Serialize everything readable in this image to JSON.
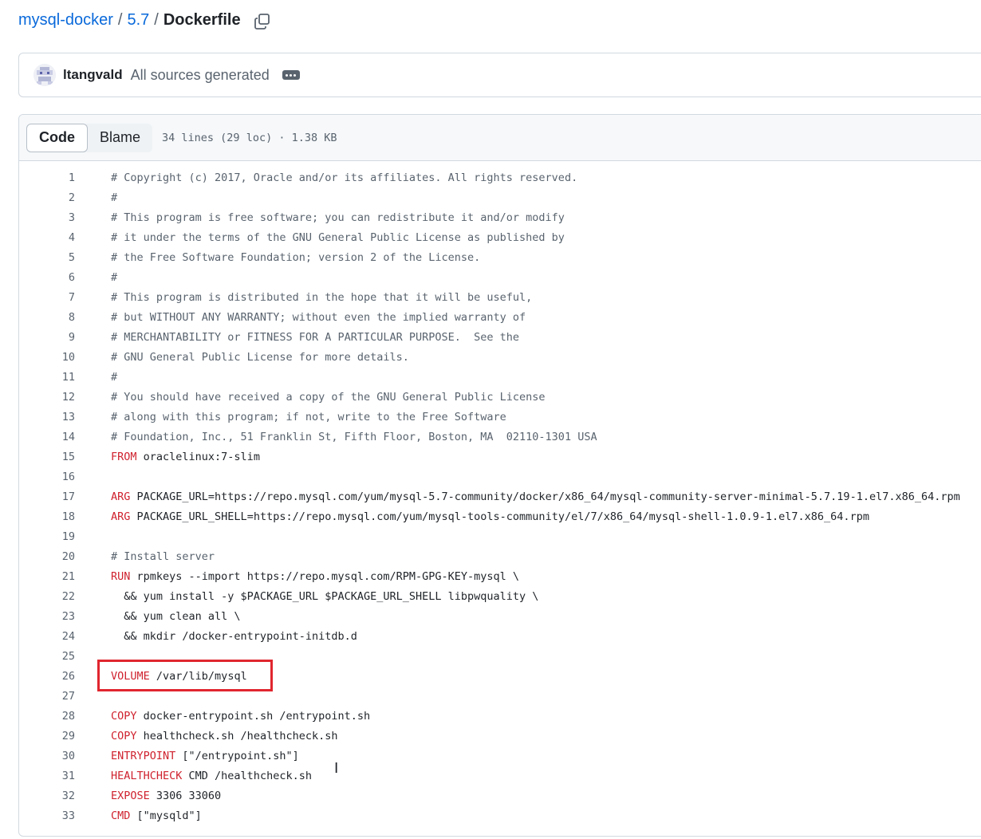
{
  "breadcrumb": {
    "repo": "mysql-docker",
    "sep1": "/",
    "dir": "5.7",
    "sep2": "/",
    "file": "Dockerfile"
  },
  "commit": {
    "author": "ltangvald",
    "message": "All sources generated"
  },
  "file_header": {
    "code_tab": "Code",
    "blame_tab": "Blame",
    "info": "34 lines (29 loc) · 1.38 KB"
  },
  "code_lines": [
    {
      "n": "1",
      "kw": "",
      "text": "# Copyright (c) 2017, Oracle and/or its affiliates. All rights reserved.",
      "comment": true
    },
    {
      "n": "2",
      "kw": "",
      "text": "#",
      "comment": true
    },
    {
      "n": "3",
      "kw": "",
      "text": "# This program is free software; you can redistribute it and/or modify",
      "comment": true
    },
    {
      "n": "4",
      "kw": "",
      "text": "# it under the terms of the GNU General Public License as published by",
      "comment": true
    },
    {
      "n": "5",
      "kw": "",
      "text": "# the Free Software Foundation; version 2 of the License.",
      "comment": true
    },
    {
      "n": "6",
      "kw": "",
      "text": "#",
      "comment": true
    },
    {
      "n": "7",
      "kw": "",
      "text": "# This program is distributed in the hope that it will be useful,",
      "comment": true
    },
    {
      "n": "8",
      "kw": "",
      "text": "# but WITHOUT ANY WARRANTY; without even the implied warranty of",
      "comment": true
    },
    {
      "n": "9",
      "kw": "",
      "text": "# MERCHANTABILITY or FITNESS FOR A PARTICULAR PURPOSE.  See the",
      "comment": true
    },
    {
      "n": "10",
      "kw": "",
      "text": "# GNU General Public License for more details.",
      "comment": true
    },
    {
      "n": "11",
      "kw": "",
      "text": "#",
      "comment": true
    },
    {
      "n": "12",
      "kw": "",
      "text": "# You should have received a copy of the GNU General Public License",
      "comment": true
    },
    {
      "n": "13",
      "kw": "",
      "text": "# along with this program; if not, write to the Free Software",
      "comment": true
    },
    {
      "n": "14",
      "kw": "",
      "text": "# Foundation, Inc., 51 Franklin St, Fifth Floor, Boston, MA  02110-1301 USA",
      "comment": true
    },
    {
      "n": "15",
      "kw": "FROM",
      "text": " oraclelinux:7-slim",
      "comment": false
    },
    {
      "n": "16",
      "kw": "",
      "text": "",
      "comment": false
    },
    {
      "n": "17",
      "kw": "ARG",
      "text": " PACKAGE_URL=https://repo.mysql.com/yum/mysql-5.7-community/docker/x86_64/mysql-community-server-minimal-5.7.19-1.el7.x86_64.rpm",
      "comment": false
    },
    {
      "n": "18",
      "kw": "ARG",
      "text": " PACKAGE_URL_SHELL=https://repo.mysql.com/yum/mysql-tools-community/el/7/x86_64/mysql-shell-1.0.9-1.el7.x86_64.rpm",
      "comment": false
    },
    {
      "n": "19",
      "kw": "",
      "text": "",
      "comment": false
    },
    {
      "n": "20",
      "kw": "",
      "text": "# Install server",
      "comment": true
    },
    {
      "n": "21",
      "kw": "RUN",
      "text": " rpmkeys --import https://repo.mysql.com/RPM-GPG-KEY-mysql \\",
      "comment": false
    },
    {
      "n": "22",
      "kw": "",
      "text": "  && yum install -y $PACKAGE_URL $PACKAGE_URL_SHELL libpwquality \\",
      "comment": false
    },
    {
      "n": "23",
      "kw": "",
      "text": "  && yum clean all \\",
      "comment": false
    },
    {
      "n": "24",
      "kw": "",
      "text": "  && mkdir /docker-entrypoint-initdb.d",
      "comment": false
    },
    {
      "n": "25",
      "kw": "",
      "text": "",
      "comment": false
    },
    {
      "n": "26",
      "kw": "VOLUME",
      "text": " /var/lib/mysql",
      "comment": false
    },
    {
      "n": "27",
      "kw": "",
      "text": "",
      "comment": false
    },
    {
      "n": "28",
      "kw": "COPY",
      "text": " docker-entrypoint.sh /entrypoint.sh",
      "comment": false
    },
    {
      "n": "29",
      "kw": "COPY",
      "text": " healthcheck.sh /healthcheck.sh",
      "comment": false
    },
    {
      "n": "30",
      "kw": "ENTRYPOINT",
      "text": " [\"/entrypoint.sh\"]",
      "comment": false
    },
    {
      "n": "31",
      "kw": "HEALTHCHECK",
      "text": " CMD /healthcheck.sh",
      "comment": false
    },
    {
      "n": "32",
      "kw": "EXPOSE",
      "text": " 3306 33060",
      "comment": false
    },
    {
      "n": "33",
      "kw": "CMD",
      "text": " [\"mysqld\"]",
      "comment": false
    }
  ],
  "colors": {
    "link": "#0969da",
    "keyword": "#cf222e",
    "comment": "#59636e",
    "highlight_box": "#e0262e"
  },
  "icons": [
    "copy-icon",
    "avatar",
    "ellipsis-icon"
  ]
}
